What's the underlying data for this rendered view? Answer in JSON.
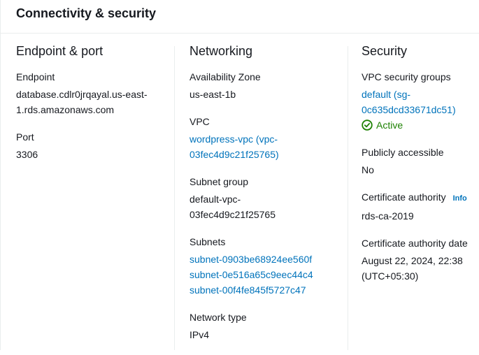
{
  "panel": {
    "title": "Connectivity & security"
  },
  "endpoint_port": {
    "heading": "Endpoint & port",
    "endpoint_label": "Endpoint",
    "endpoint_value_line1": "database.cdlr0jrqayal.us-east-",
    "endpoint_value_line2": "1.rds.amazonaws.com",
    "port_label": "Port",
    "port_value": "3306"
  },
  "networking": {
    "heading": "Networking",
    "az_label": "Availability Zone",
    "az_value": "us-east-1b",
    "vpc_label": "VPC",
    "vpc_link_line1": "wordpress-vpc (vpc-",
    "vpc_link_line2": "03fec4d9c21f25765)",
    "subnet_group_label": "Subnet group",
    "subnet_group_line1": "default-vpc-",
    "subnet_group_line2": "03fec4d9c21f25765",
    "subnets_label": "Subnets",
    "subnets": [
      "subnet-0903be68924ee560f",
      "subnet-0e516a65c9eec44c4",
      "subnet-00f4fe845f5727c47"
    ],
    "network_type_label": "Network type",
    "network_type_value": "IPv4"
  },
  "security": {
    "heading": "Security",
    "sg_label": "VPC security groups",
    "sg_link_line1": "default (sg-",
    "sg_link_line2": "0c635dcd33671dc51)",
    "sg_status": "Active",
    "public_label": "Publicly accessible",
    "public_value": "No",
    "ca_label": "Certificate authority",
    "ca_info": "Info",
    "ca_value": "rds-ca-2019",
    "ca_date_label": "Certificate authority date",
    "ca_date_line1": "August 22, 2024, 22:38",
    "ca_date_line2": "(UTC+05:30)"
  },
  "colors": {
    "link": "#0073bb",
    "success": "#1d8102",
    "divider": "#eaeded",
    "text": "#16191f"
  },
  "icons": {
    "status": "check-circle-icon"
  }
}
